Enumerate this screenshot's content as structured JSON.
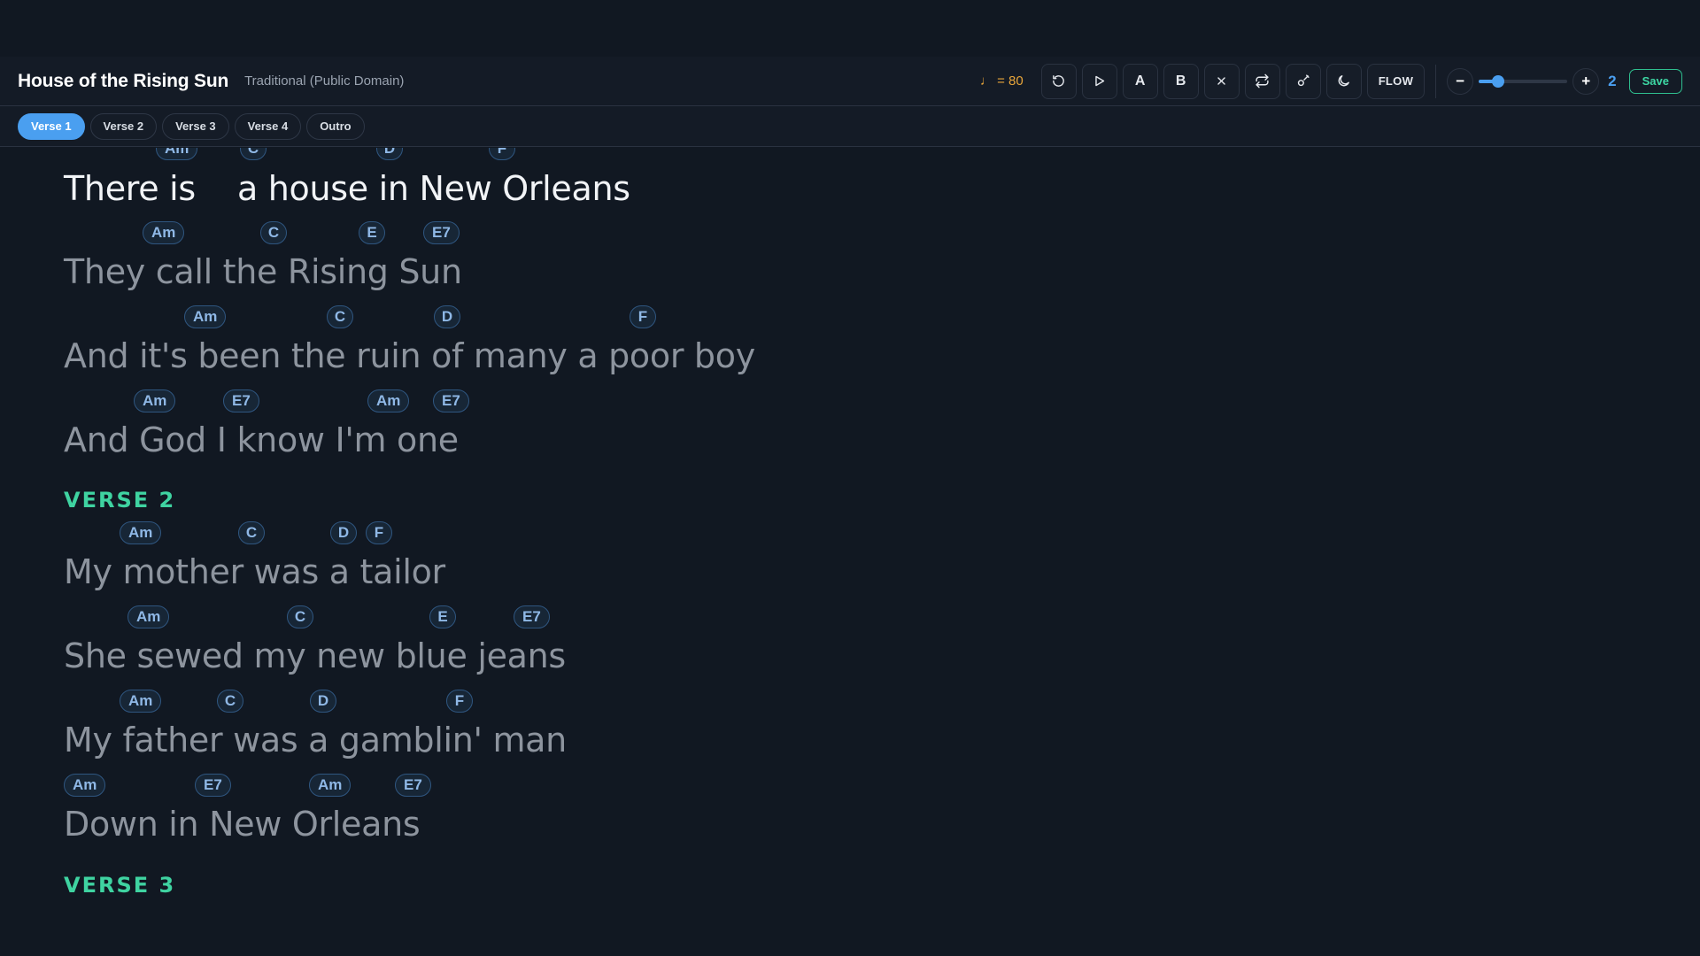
{
  "header": {
    "title": "House of the Rising Sun",
    "artist": "Traditional (Public Domain)",
    "tempo": "♩ = 80",
    "bold_a_label": "A",
    "bold_b_label": "B",
    "flow_label": "FLOW",
    "zoom_minus": "−",
    "zoom_plus": "+",
    "zoom_value": "2",
    "zoom_fraction": 0.18,
    "save_label": "Save"
  },
  "tabs": [
    {
      "label": "Verse 1",
      "active": true
    },
    {
      "label": "Verse 2",
      "active": false
    },
    {
      "label": "Verse 3",
      "active": false
    },
    {
      "label": "Verse 4",
      "active": false
    },
    {
      "label": "Outro",
      "active": false
    }
  ],
  "sections": [
    {
      "heading": "VERSE 2"
    },
    {
      "heading": "VERSE 3"
    }
  ],
  "lines": [
    {
      "lyric": "There is    a house in New Orleans",
      "chords": [
        "Am",
        "C",
        "D",
        "F"
      ]
    },
    {
      "lyric": "They call the Rising Sun",
      "chords": [
        "Am",
        "C",
        "E",
        "E7"
      ]
    },
    {
      "lyric": "And it's been the ruin of many a poor boy",
      "chords": [
        "Am",
        "C",
        "D",
        "F"
      ]
    },
    {
      "lyric": "And God I know I'm one",
      "chords": [
        "Am",
        "E7",
        "Am",
        "E7"
      ]
    },
    {
      "lyric": "My mother was a tailor",
      "chords": [
        "Am",
        "C",
        "D",
        "F"
      ]
    },
    {
      "lyric": "She sewed my new blue jeans",
      "chords": [
        "Am",
        "C",
        "E",
        "E7"
      ]
    },
    {
      "lyric": "My father was a gamblin' man",
      "chords": [
        "Am",
        "C",
        "D",
        "F"
      ]
    },
    {
      "lyric": "Down in New Orleans",
      "chords": [
        "Am",
        "E7",
        "Am",
        "E7"
      ]
    }
  ],
  "colors": {
    "accent": "#4a9ff0",
    "section_heading": "#3fd3a1",
    "tempo": "#e8a53a",
    "save": "#3dd9a5"
  }
}
